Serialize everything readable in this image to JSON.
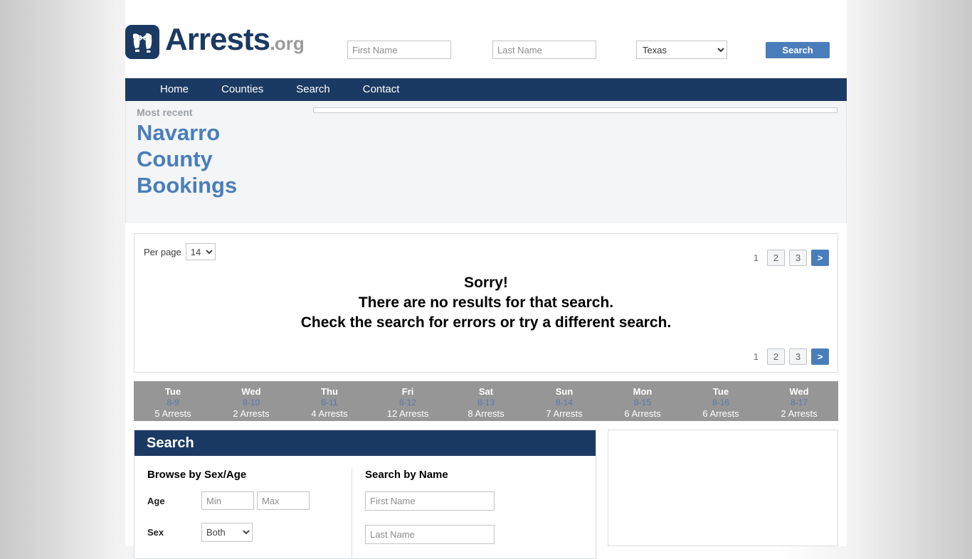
{
  "brand": {
    "name": "Arrests",
    "dot": ".",
    "tld": "org",
    "logo_icon": "handcuffs-icon"
  },
  "header": {
    "first_name_placeholder": "First Name",
    "first_name_value": "",
    "last_name_placeholder": "Last Name",
    "last_name_value": "",
    "state_selected": "Texas",
    "state_options": [
      "Texas"
    ],
    "search_button": "Search"
  },
  "nav": {
    "items": [
      {
        "label": "Home"
      },
      {
        "label": "Counties"
      },
      {
        "label": "Search"
      },
      {
        "label": "Contact"
      }
    ]
  },
  "hero": {
    "eyebrow": "Most recent",
    "title": "Navarro County Bookings"
  },
  "results": {
    "per_page_label": "Per page",
    "per_page_value": "14",
    "per_page_options": [
      "14"
    ],
    "pagination": {
      "current": "1",
      "pages": [
        "2",
        "3"
      ],
      "next": ">"
    },
    "empty_message": {
      "line1": "Sorry!",
      "line2": "There are no results for that search.",
      "line3": "Check the search for errors or try a different search."
    }
  },
  "day_strip": {
    "days": [
      {
        "name": "Tue",
        "date": "8-9",
        "count": "5 Arrests"
      },
      {
        "name": "Wed",
        "date": "8-10",
        "count": "2 Arrests"
      },
      {
        "name": "Thu",
        "date": "8-11",
        "count": "4 Arrests"
      },
      {
        "name": "Fri",
        "date": "8-12",
        "count": "12 Arrests"
      },
      {
        "name": "Sat",
        "date": "8-13",
        "count": "8 Arrests"
      },
      {
        "name": "Sun",
        "date": "8-14",
        "count": "7 Arrests"
      },
      {
        "name": "Mon",
        "date": "8-15",
        "count": "6 Arrests"
      },
      {
        "name": "Tue",
        "date": "8-16",
        "count": "6 Arrests"
      },
      {
        "name": "Wed",
        "date": "8-17",
        "count": "2 Arrests"
      }
    ]
  },
  "search_panel": {
    "title": "Search",
    "browse_heading": "Browse by Sex/Age",
    "age_label": "Age",
    "age_min_placeholder": "Min",
    "age_max_placeholder": "Max",
    "sex_label": "Sex",
    "sex_selected": "Both",
    "sex_options": [
      "Both"
    ],
    "name_heading": "Search by Name",
    "first_name_placeholder": "First Name",
    "last_name_placeholder": "Last Name"
  },
  "colors": {
    "navy": "#1b3a63",
    "accent_blue": "#4a7ebb",
    "day_strip_gray": "#969696",
    "hero_bg": "#f3f5f7"
  }
}
